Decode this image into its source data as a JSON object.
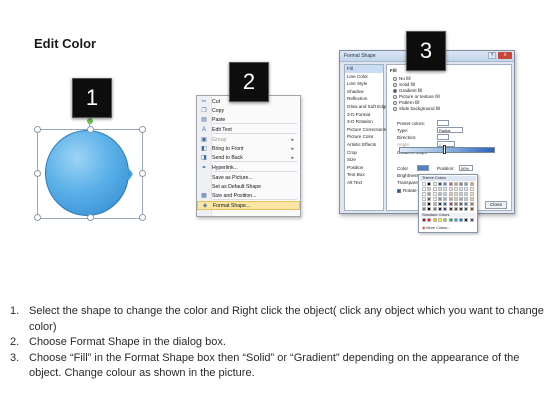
{
  "title": "Edit Color",
  "steps_badges": [
    "1",
    "2",
    "3"
  ],
  "context_menu": {
    "items": [
      {
        "label": "Cut",
        "icon": "cut-icon",
        "glyph": "✂",
        "disabled": false,
        "arrow": false,
        "highlight": false
      },
      {
        "label": "Copy",
        "icon": "copy-icon",
        "glyph": "❐",
        "disabled": false,
        "arrow": false,
        "highlight": false
      },
      {
        "label": "Paste",
        "icon": "paste-icon",
        "glyph": "▤",
        "disabled": false,
        "arrow": false,
        "highlight": false
      },
      {
        "label": "Edit Text",
        "icon": "edit-text-icon",
        "glyph": "A",
        "disabled": false,
        "arrow": false,
        "highlight": false
      },
      {
        "label": "Group",
        "icon": "group-icon",
        "glyph": "▣",
        "disabled": true,
        "arrow": true,
        "highlight": false
      },
      {
        "label": "Bring to Front",
        "icon": "bring-front-icon",
        "glyph": "◧",
        "disabled": false,
        "arrow": true,
        "highlight": false
      },
      {
        "label": "Send to Back",
        "icon": "send-back-icon",
        "glyph": "◨",
        "disabled": false,
        "arrow": true,
        "highlight": false
      },
      {
        "label": "Hyperlink...",
        "icon": "hyperlink-icon",
        "glyph": "⚭",
        "disabled": false,
        "arrow": false,
        "highlight": false
      },
      {
        "label": "Save as Picture...",
        "icon": "",
        "glyph": "",
        "disabled": false,
        "arrow": false,
        "highlight": false
      },
      {
        "label": "Set as Default Shape",
        "icon": "",
        "glyph": "",
        "disabled": false,
        "arrow": false,
        "highlight": false
      },
      {
        "label": "Size and Position...",
        "icon": "size-position-icon",
        "glyph": "▦",
        "disabled": false,
        "arrow": false,
        "highlight": false
      },
      {
        "label": "Format Shape...",
        "icon": "format-shape-icon",
        "glyph": "◈",
        "disabled": false,
        "arrow": false,
        "highlight": true
      }
    ]
  },
  "dialog": {
    "title": "Format Shape",
    "help_label": "?",
    "close_x": "x",
    "categories": [
      "Fill",
      "Line Color",
      "Line Style",
      "Shadow",
      "Reflection",
      "Glow and Soft Edges",
      "3-D Format",
      "3-D Rotation",
      "Picture Corrections",
      "Picture Color",
      "Artistic Effects",
      "Crop",
      "Size",
      "Position",
      "Text Box",
      "Alt Text"
    ],
    "selected_category": "Fill",
    "fill_heading": "Fill",
    "fill_options": [
      {
        "label": "No fill",
        "checked": false
      },
      {
        "label": "Solid fill",
        "checked": false
      },
      {
        "label": "Gradient fill",
        "checked": true
      },
      {
        "label": "Picture or texture fill",
        "checked": false
      },
      {
        "label": "Pattern fill",
        "checked": false
      },
      {
        "label": "Slide background fill",
        "checked": false
      }
    ],
    "preset_colors_label": "Preset colors:",
    "type_label": "Type:",
    "type_value": "Radial",
    "direction_label": "Direction:",
    "angle_label": "Angle:",
    "angle_value": "0°",
    "gradient_stops_label": "Gradient stops",
    "color_label": "Color",
    "position_label": "Position:",
    "position_value": "50%",
    "brightness_label": "Brightness:",
    "transparency_label": "Transparency:",
    "rotate_label": "Rotate with shape",
    "close_label": "Close"
  },
  "palette": {
    "theme_header": "Theme Colors",
    "standard_header": "Standard Colors",
    "more_label": "More Colors...",
    "theme_colors": [
      "#ffffff",
      "#000000",
      "#eeece1",
      "#1f497d",
      "#4f81bd",
      "#c0504d",
      "#9bbb59",
      "#8064a2",
      "#4bacc6",
      "#f79646"
    ],
    "standard_colors": [
      "#c00000",
      "#ff0000",
      "#ffc000",
      "#ffff00",
      "#92d050",
      "#00b050",
      "#00b0f0",
      "#0070c0",
      "#002060",
      "#7030a0"
    ]
  },
  "instructions": [
    {
      "num": "1.",
      "text": "Select the shape to change the color and Right click the object( click any object which you want to change color)"
    },
    {
      "num": "2.",
      "text": "Choose Format Shape in the dialog box."
    },
    {
      "num": "3.",
      "text": "Choose “Fill” in the Format Shape box then “Solid” or “Gradient” depending on the appearance of the object. Change colour as shown in the picture."
    }
  ]
}
